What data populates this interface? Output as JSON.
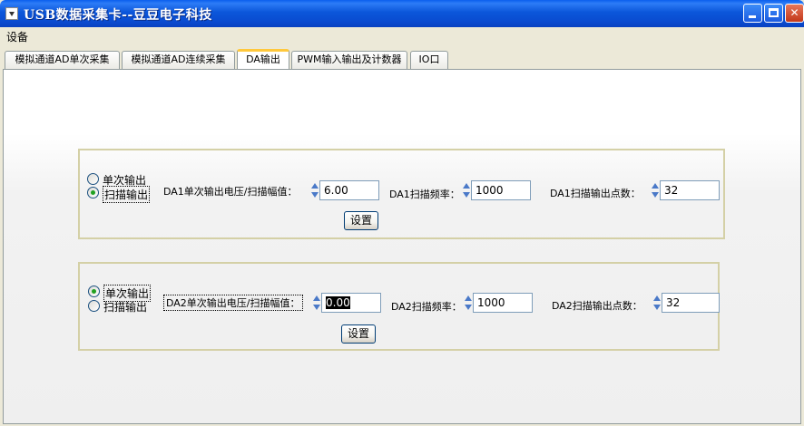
{
  "window": {
    "title": "USB数据采集卡--豆豆电子科技",
    "min_icon": "minimize-icon",
    "max_icon": "maximize-icon",
    "close_icon": "close-icon",
    "close_glyph": "✕"
  },
  "menu": {
    "settings": "设备"
  },
  "tabs": [
    {
      "label": "模拟通道AD单次采集",
      "active": false
    },
    {
      "label": "模拟通道AD连续采集",
      "active": false
    },
    {
      "label": "DA输出",
      "active": true
    },
    {
      "label": "PWM输入输出及计数器",
      "active": false
    },
    {
      "label": "IO口",
      "active": false
    }
  ],
  "da1": {
    "radio_single": "单次输出",
    "radio_scan": "扫描输出",
    "selected": "scan",
    "voltage_label": "DA1单次输出电压/扫描幅值：",
    "voltage_value": "6.00",
    "freq_label": "DA1扫描频率：",
    "freq_value": "1000",
    "points_label": "DA1扫描输出点数：",
    "points_value": "32",
    "set_button": "设置"
  },
  "da2": {
    "radio_single": "单次输出",
    "radio_scan": "扫描输出",
    "selected": "single",
    "voltage_label": "DA2单次输出电压/扫描幅值：",
    "voltage_value": "0.00",
    "freq_label": "DA2扫描频率：",
    "freq_value": "1000",
    "points_label": "DA2扫描输出点数：",
    "points_value": "32",
    "set_button": "设置"
  },
  "colors": {
    "titlebar": "#0A4BD0",
    "tab_active_accent": "#FFC83C",
    "group_border": "#D4D0A6",
    "radio_dot": "#21A121"
  }
}
